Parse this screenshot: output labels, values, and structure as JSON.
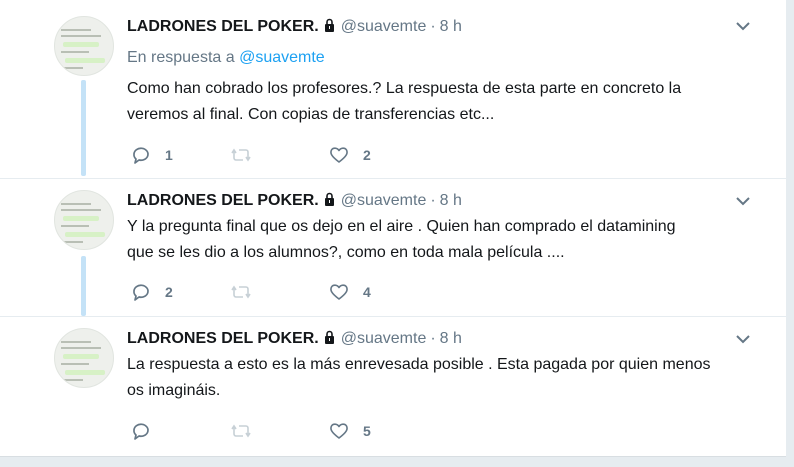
{
  "tweets": [
    {
      "name": "LADRONES DEL POKER.",
      "handle": "@suavemte",
      "separator": "·",
      "time": "8 h",
      "reply_prefix": "En respuesta a",
      "reply_mention": "@suavemte",
      "text_line1": "Como han cobrado los profesores.? La respuesta de esta parte en concreto la",
      "text_line2": "veremos al final. Con copias de transferencias etc...",
      "replies": "1",
      "retweets": "",
      "likes": "2"
    },
    {
      "name": "LADRONES DEL POKER.",
      "handle": "@suavemte",
      "separator": "·",
      "time": "8 h",
      "text_line1": "Y la pregunta final que os dejo en el aire . Quien han comprado el datamining",
      "text_line2": "que se les dio a los alumnos?, como en toda mala película ....",
      "replies": "2",
      "retweets": "",
      "likes": "4"
    },
    {
      "name": "LADRONES DEL POKER.",
      "handle": "@suavemte",
      "separator": "·",
      "time": "8 h",
      "text_line1": "La respuesta a esto es la más enrevesada posible . Esta pagada por quien menos",
      "text_line2": "os imagináis.",
      "replies": "",
      "retweets": "",
      "likes": "5"
    }
  ],
  "icons": {
    "lock": "lock-icon",
    "caret": "chevron-down-icon",
    "reply": "reply-icon",
    "retweet": "retweet-icon",
    "like": "heart-icon"
  },
  "colors": {
    "link": "#1da1f2",
    "secondary_text": "#657786",
    "thread_line": "#c4e2f7"
  }
}
